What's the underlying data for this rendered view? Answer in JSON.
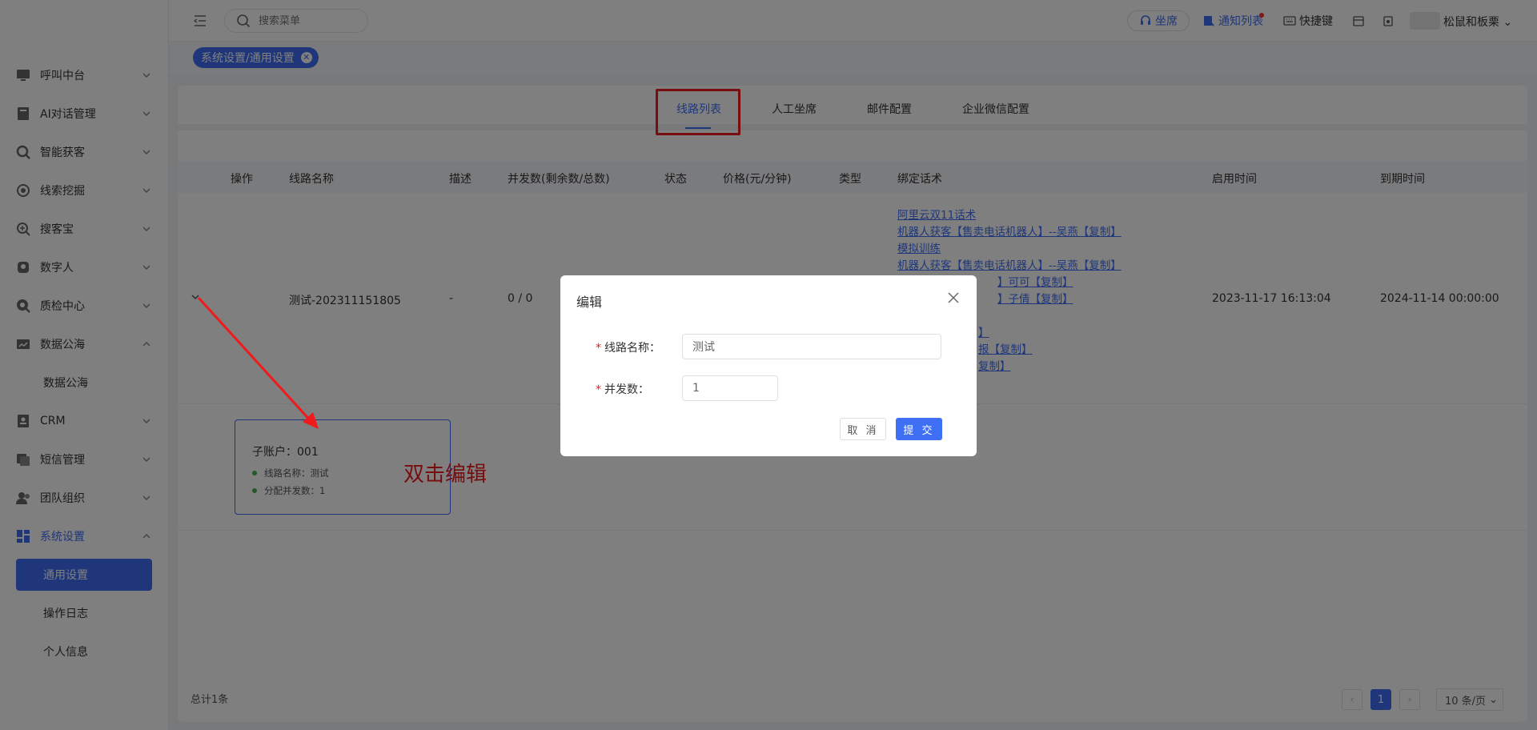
{
  "sidebar": {
    "items": [
      {
        "label": "呼叫中台",
        "icon": "monitor-icon",
        "expanded": false
      },
      {
        "label": "AI对话管理",
        "icon": "book-icon",
        "expanded": false
      },
      {
        "label": "智能获客",
        "icon": "search-target-icon",
        "expanded": false
      },
      {
        "label": "线索挖掘",
        "icon": "target-icon",
        "expanded": false
      },
      {
        "label": "搜客宝",
        "icon": "magnifier-icon",
        "expanded": false
      },
      {
        "label": "数字人",
        "icon": "person-icon",
        "expanded": false
      },
      {
        "label": "质检中心",
        "icon": "inspect-icon",
        "expanded": false
      },
      {
        "label": "数据公海",
        "icon": "chart-icon",
        "expanded": true
      },
      {
        "label": "CRM",
        "icon": "crm-icon",
        "expanded": false
      },
      {
        "label": "短信管理",
        "icon": "sms-icon",
        "expanded": false
      },
      {
        "label": "团队组织",
        "icon": "team-icon",
        "expanded": false
      },
      {
        "label": "系统设置",
        "icon": "grid-icon",
        "expanded": true
      }
    ],
    "sub_data_sea": "数据公海",
    "sub_system": [
      "通用设置",
      "操作日志",
      "个人信息"
    ]
  },
  "header": {
    "search_placeholder": "搜索菜单",
    "seat": "坐席",
    "notify": "通知列表",
    "shortcut": "快捷键",
    "user": "松鼠和板栗"
  },
  "breadcrumb_tag": "系统设置/通用设置",
  "tabs": [
    "线路列表",
    "人工坐席",
    "邮件配置",
    "企业微信配置"
  ],
  "active_tab": "线路列表",
  "table": {
    "headers": [
      "操作",
      "线路名称",
      "描述",
      "并发数(剩余数/总数)",
      "状态",
      "价格(元/分钟)",
      "类型",
      "绑定话术",
      "启用时间",
      "到期时间"
    ],
    "row": {
      "name": "测试-202311151805",
      "desc": "-",
      "concurrency": "0 / 0",
      "start_time": "2023-11-17 16:13:04",
      "end_time": "2024-11-14 00:00:00",
      "scripts": [
        "阿里云双11话术",
        "机器人获客【售卖电话机器人】--吴燕【复制】",
        "模拟训练",
        "机器人获客【售卖电话机器人】--吴燕【复制】",
        "】可可【复制】",
        "】子倩【复制】",
        "】",
        "报【复制】",
        "复制】"
      ]
    }
  },
  "sub_account": {
    "title": "子账户：001",
    "line_name": "线路名称：测试",
    "concurrency": "分配并发数：1"
  },
  "annotation": "双击编辑",
  "footer": {
    "total": "总计1条",
    "current_page": "1",
    "page_size": "10 条/页"
  },
  "modal": {
    "title": "编辑",
    "line_name_label": "线路名称",
    "line_name_value": "测试",
    "concurrency_label": "并发数",
    "concurrency_value": "1",
    "cancel": "取 消",
    "submit": "提 交"
  },
  "colors": {
    "primary": "#3f6ff5",
    "annotation_red": "#f0191c"
  }
}
